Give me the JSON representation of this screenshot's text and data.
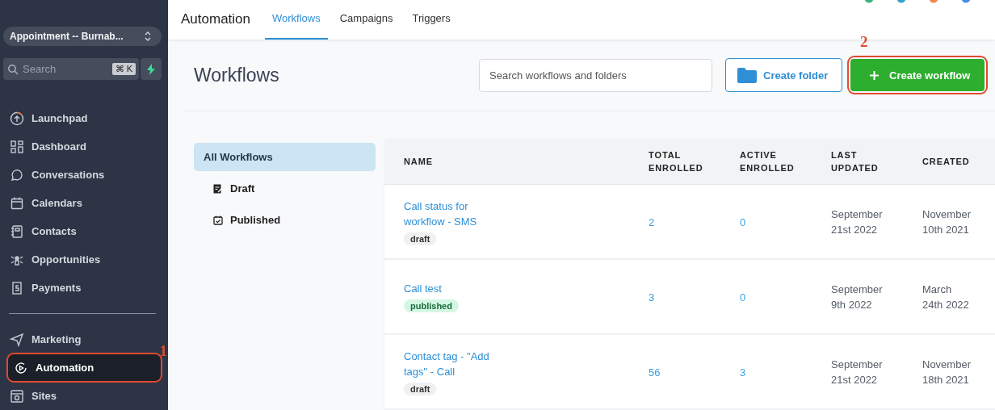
{
  "sidebar": {
    "account": "Appointment -- Burnab...",
    "search": {
      "placeholder": "Search",
      "shortcut": "⌘ K"
    },
    "items": [
      {
        "label": "Launchpad",
        "selected": false
      },
      {
        "label": "Dashboard",
        "selected": false
      },
      {
        "label": "Conversations",
        "selected": false
      },
      {
        "label": "Calendars",
        "selected": false
      },
      {
        "label": "Contacts",
        "selected": false
      },
      {
        "label": "Opportunities",
        "selected": false
      },
      {
        "label": "Payments",
        "selected": false
      },
      {
        "label": "Marketing",
        "selected": false
      },
      {
        "label": "Automation",
        "selected": true,
        "callout": "1"
      },
      {
        "label": "Sites",
        "selected": false
      }
    ]
  },
  "header": {
    "title": "Automation",
    "tabs": [
      {
        "label": "Workflows",
        "selected": true
      },
      {
        "label": "Campaigns",
        "selected": false
      },
      {
        "label": "Triggers",
        "selected": false
      }
    ]
  },
  "page": {
    "title": "Workflows",
    "search": {
      "placeholder": "Search workflows and folders"
    },
    "create_folder": "Create folder",
    "create_workflow": {
      "label": "Create workflow",
      "callout": "2"
    }
  },
  "filters": [
    {
      "label": "All Workflows",
      "selected": true
    },
    {
      "label": "Draft",
      "selected": false
    },
    {
      "label": "Published",
      "selected": false
    }
  ],
  "table": {
    "columns": [
      [
        "NAME"
      ],
      [
        "TOTAL",
        "ENROLLED"
      ],
      [
        "ACTIVE",
        "ENROLLED"
      ],
      [
        "LAST",
        "UPDATED"
      ],
      [
        "CREATED"
      ]
    ],
    "rows": [
      {
        "name": "Call status for workflow - SMS",
        "status": "draft",
        "total": "2",
        "active": "0",
        "updated": "September 21st 2022",
        "created": "November 10th 2021"
      },
      {
        "name": "Call test",
        "status": "published",
        "total": "3",
        "active": "0",
        "updated": "September 9th 2022",
        "created": "March 24th 2022"
      },
      {
        "name": "Contact tag - \"Add tags\" - Call",
        "status": "draft",
        "total": "56",
        "active": "3",
        "updated": "September 21st 2022",
        "created": "November 18th 2021"
      }
    ]
  }
}
